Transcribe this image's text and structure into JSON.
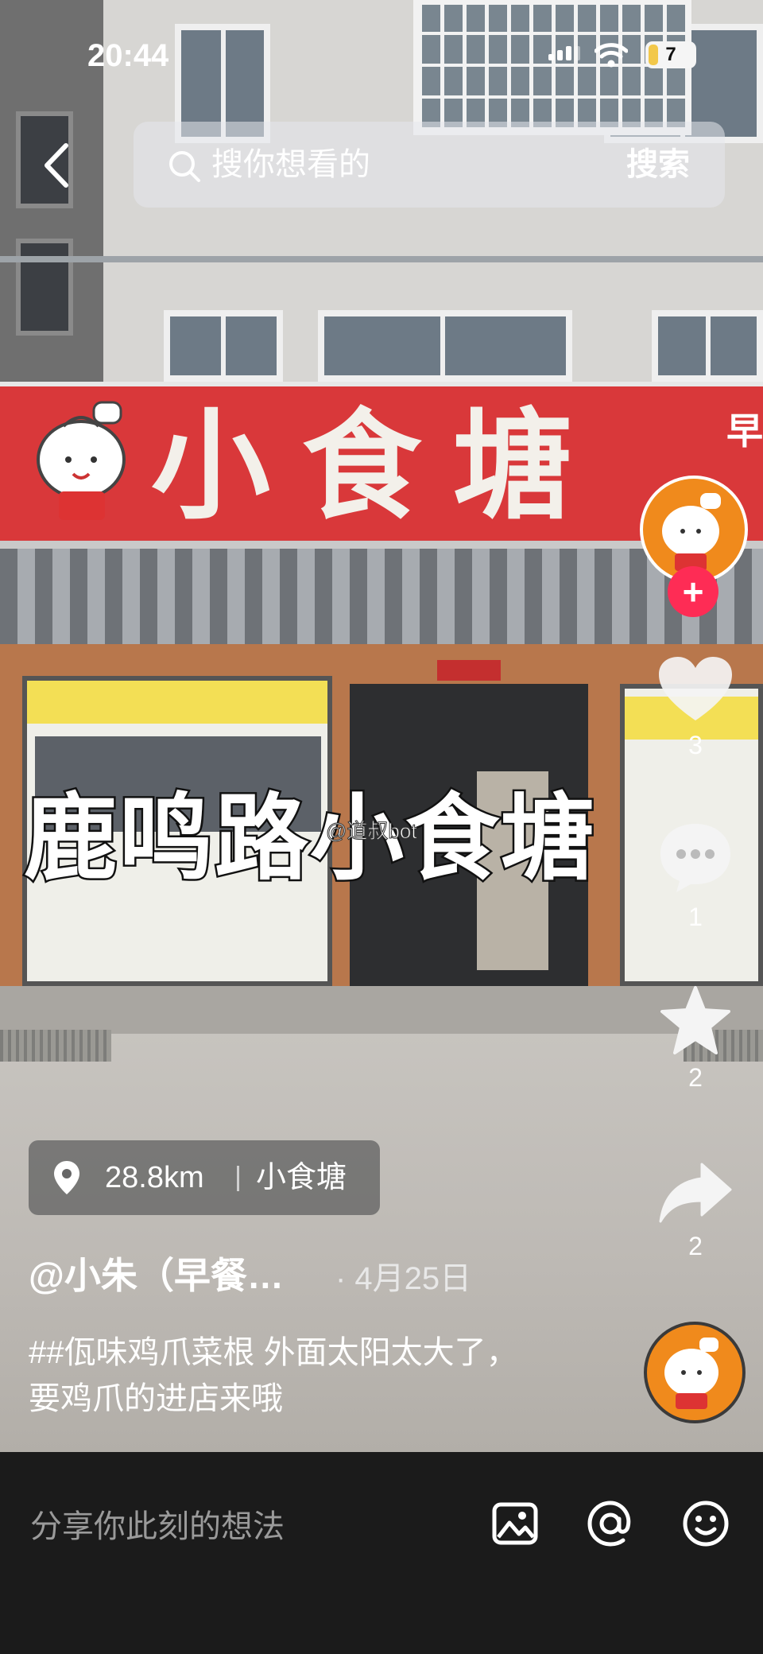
{
  "status_bar": {
    "time": "20:44",
    "battery": "7"
  },
  "search": {
    "placeholder": "搜你想看的",
    "button_label": "搜索"
  },
  "video": {
    "shop_sign": "小食塘",
    "sign_side_text": "早",
    "overlay_title": "鹿鸣路小食塘",
    "watermark": "@道叔bot"
  },
  "actions": {
    "like_count": "3",
    "comment_count": "1",
    "favorite_count": "2",
    "share_count": "2"
  },
  "location": {
    "distance": "28.8km",
    "name": "小食塘"
  },
  "post": {
    "author": "@小朱（早餐…",
    "date": "· 4月25日",
    "description": "##佤味鸡爪菜根 外面太阳太大了，要鸡爪的进店来哦"
  },
  "comment_bar": {
    "placeholder": "分享你此刻的想法"
  },
  "colors": {
    "accent_red": "#fe2c55",
    "avatar_orange": "#f08a1c",
    "bottom_bar": "#1b1b1b"
  }
}
